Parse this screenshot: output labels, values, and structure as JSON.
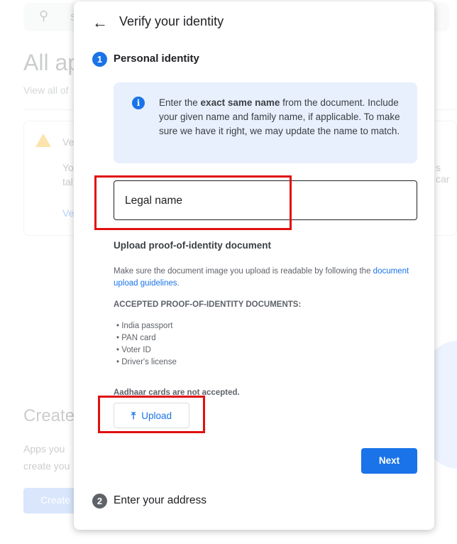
{
  "background": {
    "search_placeholder": "S",
    "title": "All ap",
    "subtitle": "View all of",
    "card_title": "Ve",
    "card_line1": "Yo",
    "card_line2": "tal",
    "card_right": "s car",
    "card_link": "Ve",
    "create_title": "Create",
    "create_line1": "Apps you",
    "create_line2": "create you",
    "create_button": "Create"
  },
  "dialog": {
    "title": "Verify your identity",
    "step1": {
      "number": "1",
      "label": "Personal identity"
    },
    "info": {
      "pre": "Enter the ",
      "bold": "exact same name",
      "post": " from the document. Include your given name and family name, if applicable. To make sure we have it right, we may update the name to match."
    },
    "legal_name": {
      "placeholder": "Legal name",
      "value": ""
    },
    "upload_heading": "Upload proof-of-identity document",
    "upload_desc": "Make sure the document image you upload is readable by following the ",
    "upload_link": "document upload guidelines",
    "upload_desc_end": ".",
    "accepted_heading": "ACCEPTED PROOF-OF-IDENTITY DOCUMENTS:",
    "accepted": [
      "India passport",
      "PAN card",
      "Voter ID",
      "Driver's license"
    ],
    "not_accepted": "Aadhaar cards are not accepted.",
    "upload_button": "Upload",
    "next_button": "Next",
    "step2": {
      "number": "2",
      "label": "Enter your address"
    }
  },
  "colors": {
    "accent": "#1a73e8",
    "highlight": "#e01010"
  }
}
